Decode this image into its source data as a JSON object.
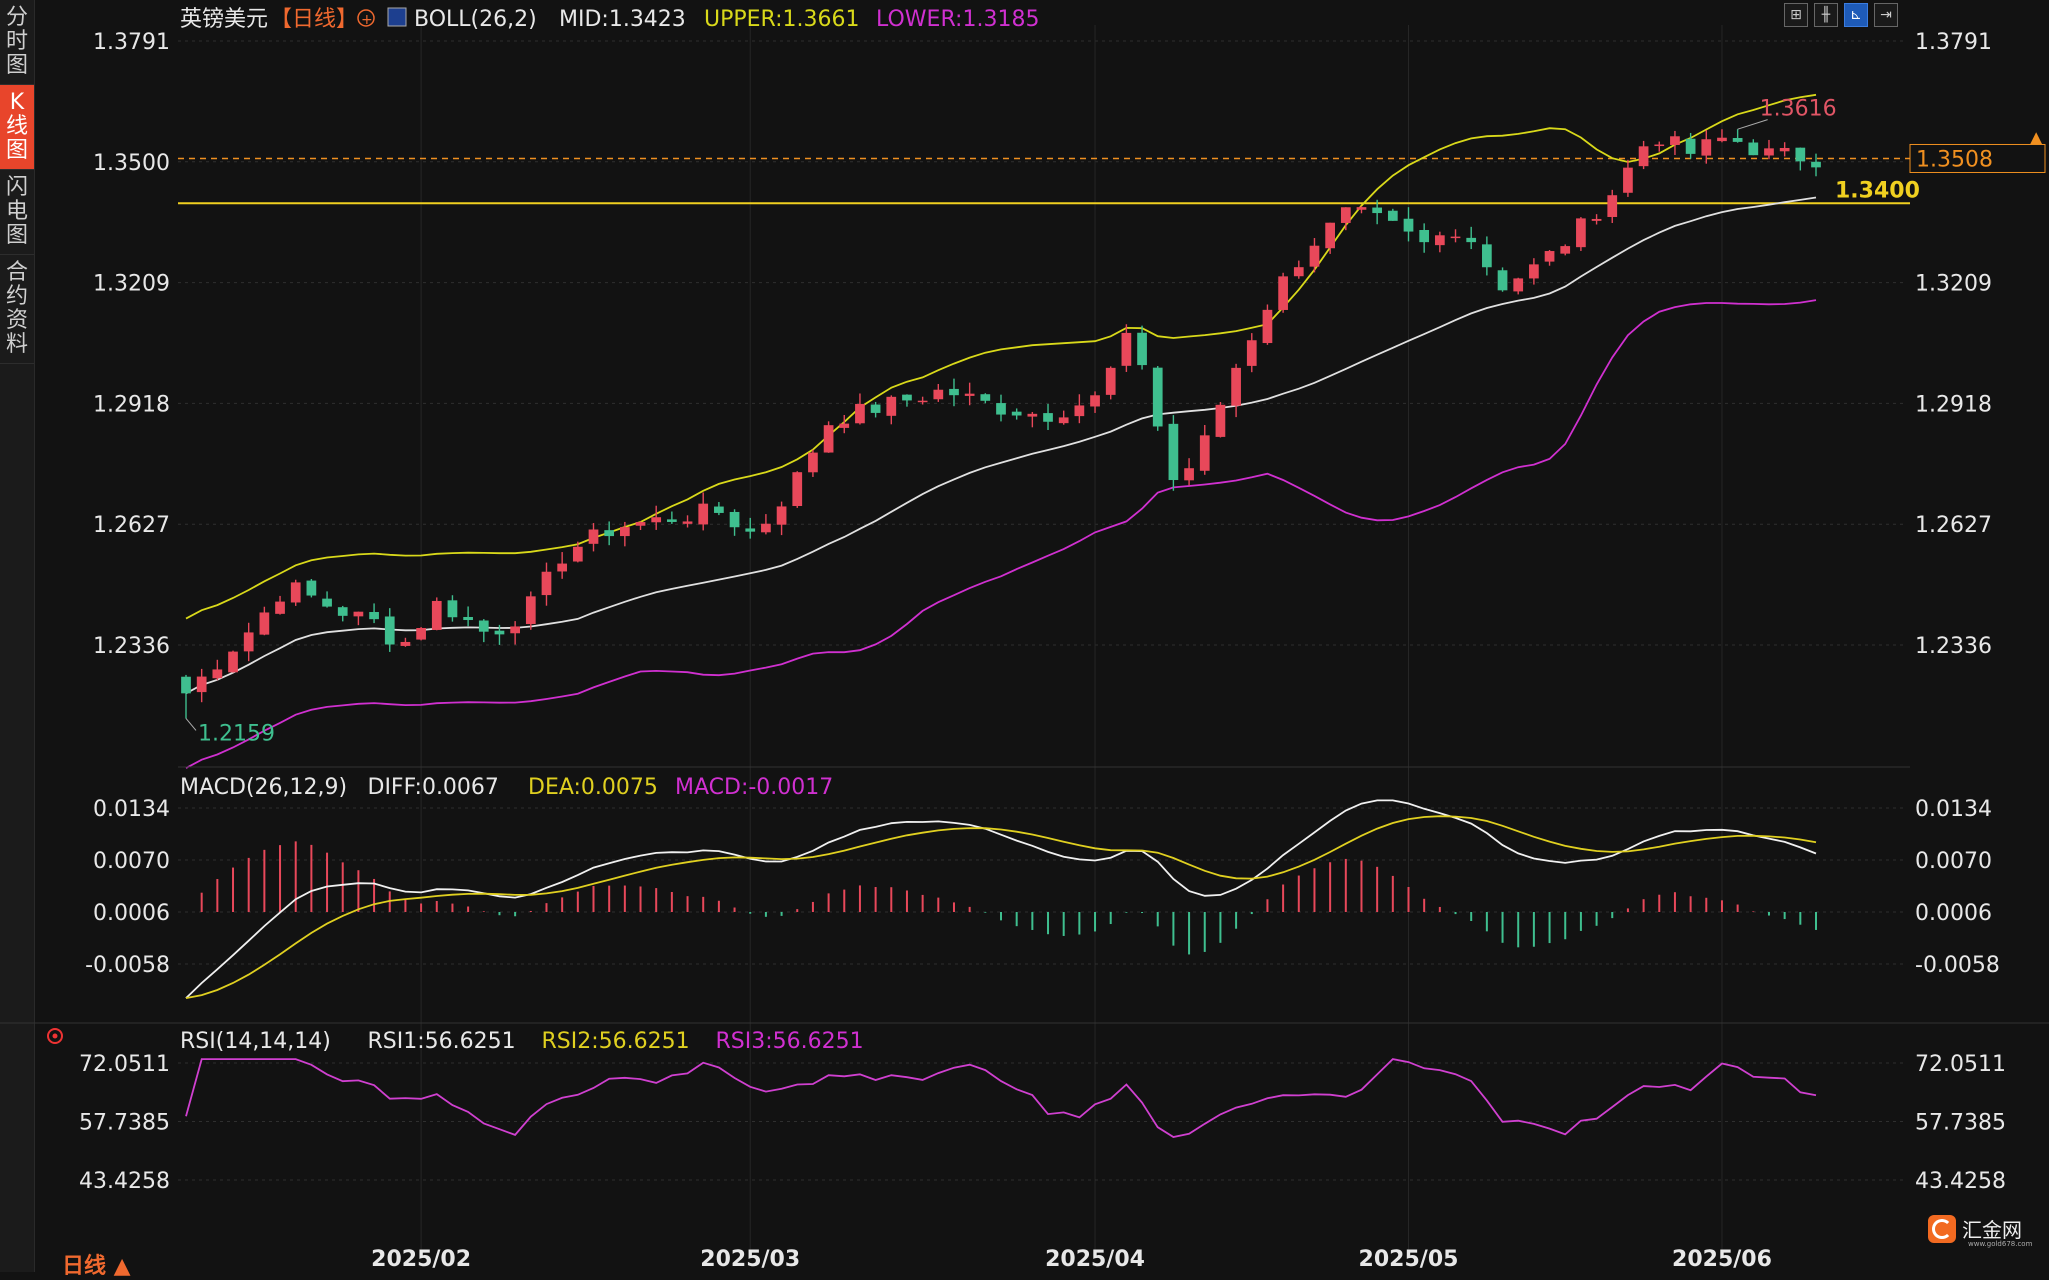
{
  "sidebar": {
    "tabs": [
      {
        "label": "分时图",
        "active": false
      },
      {
        "label": "K线图",
        "active": true
      },
      {
        "label": "闪电图",
        "active": false
      },
      {
        "label": "合约资料",
        "active": false
      }
    ]
  },
  "header": {
    "symbol": "英镑美元",
    "period_tag": "【日线】",
    "add_icon": "plus-circle-icon",
    "boll": {
      "prefix": "BOLL(26,2)",
      "mid": "MID:1.3423",
      "upper": "UPPER:1.3661",
      "lower": "LOWER:1.3185"
    },
    "macd": {
      "prefix": "MACD(26,12,9)",
      "diff": "DIFF:0.0067",
      "dea": "DEA:0.0075",
      "macd": "MACD:-0.0017"
    },
    "rsi": {
      "prefix": "RSI(14,14,14)",
      "rsi1": "RSI1:56.6251",
      "rsi2": "RSI2:56.6251",
      "rsi3": "RSI3:56.6251"
    }
  },
  "toolbar": {
    "icons": [
      "grid-layout-icon",
      "candlestick-type-icon",
      "indicator-icon",
      "exit-fullscreen-icon"
    ]
  },
  "footer": {
    "period_label": "日线 ▲"
  },
  "logo": {
    "name": "汇金网",
    "url": "www.gold678.com"
  },
  "colors": {
    "up": "#e8485a",
    "down": "#3fbf8f",
    "boll_upper": "#d9d91a",
    "boll_mid": "#e0e0e0",
    "boll_lower": "#d030d0",
    "price_line": "#f0d020",
    "last_price": "#f09020",
    "rsi": "#d040d0",
    "macd_diff": "#f0f0f0",
    "macd_dea": "#e0d020"
  },
  "chart_data": [
    {
      "type": "candlestick",
      "title": "英镑美元 日线",
      "x_ticks": [
        "2025/02",
        "2025/03",
        "2025/04",
        "2025/05",
        "2025/06"
      ],
      "y_ticks": [
        "1.3791",
        "1.3500",
        "1.3209",
        "1.2918",
        "1.2627",
        "1.2336"
      ],
      "ylim": [
        1.213,
        1.382
      ],
      "last_price": "1.3508",
      "horizontal_line": "1.3400",
      "high_label": "1.3616",
      "low_label": "1.2159",
      "overlays": [
        "BOLL upper",
        "BOLL mid",
        "BOLL lower"
      ]
    },
    {
      "type": "line",
      "title": "MACD(26,12,9)",
      "y_ticks": [
        "0.0134",
        "0.0070",
        "0.0006",
        "-0.0058"
      ],
      "series": [
        {
          "name": "DIFF"
        },
        {
          "name": "DEA"
        },
        {
          "name": "MACD"
        }
      ]
    },
    {
      "type": "line",
      "title": "RSI(14,14,14)",
      "y_ticks": [
        "72.0511",
        "57.7385",
        "43.4258"
      ],
      "series": [
        {
          "name": "RSI1"
        }
      ]
    }
  ]
}
